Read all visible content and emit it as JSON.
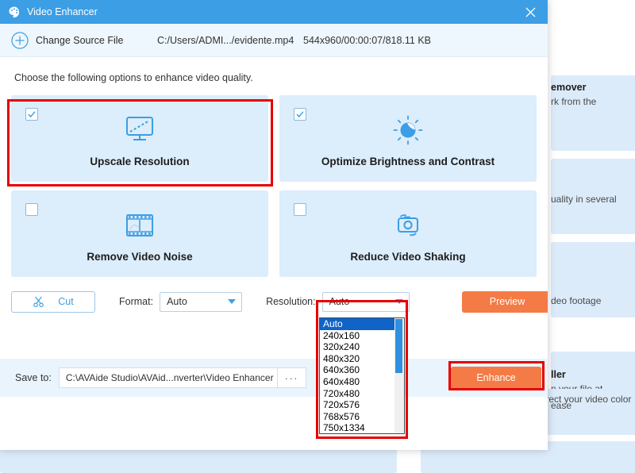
{
  "window": {
    "title": "Video Enhancer",
    "logo_icon": "palette-icon",
    "close_icon": "close-icon",
    "titlebar_color": "#3c9ee5"
  },
  "source_bar": {
    "add_icon": "plus-circle-icon",
    "change_source_label": "Change Source File",
    "file_path": "C:/Users/ADMI.../evidente.mp4",
    "file_meta": "544x960/00:00:07/818.11 KB"
  },
  "instruction": "Choose the following options to enhance video quality.",
  "options": [
    {
      "label": "Upscale Resolution",
      "icon": "monitor-upscale-icon",
      "checked": true,
      "highlighted": true
    },
    {
      "label": "Optimize Brightness and Contrast",
      "icon": "brightness-sun-icon",
      "checked": true,
      "highlighted": false
    },
    {
      "label": "Remove Video Noise",
      "icon": "film-strip-icon",
      "checked": false,
      "highlighted": false
    },
    {
      "label": "Reduce Video Shaking",
      "icon": "camera-shake-icon",
      "checked": false,
      "highlighted": false
    }
  ],
  "controls": {
    "cut_label": "Cut",
    "cut_icon": "scissors-icon",
    "format_label": "Format:",
    "format_value": "Auto",
    "resolution_label": "Resolution:",
    "resolution_value": "Auto",
    "preview_label": "Preview",
    "accent_color": "#f47b45"
  },
  "resolution_dropdown": {
    "open": true,
    "selected": "Auto",
    "options": [
      "Auto",
      "240x160",
      "320x240",
      "480x320",
      "640x360",
      "640x480",
      "720x480",
      "720x576",
      "768x576",
      "750x1334"
    ]
  },
  "save_row": {
    "save_label": "Save to:",
    "save_path": "C:\\AVAide Studio\\AVAid...nverter\\Video Enhancer",
    "browse_label": "···",
    "enhance_label": "Enhance",
    "enhance_highlighted": true
  },
  "background": {
    "cards": [
      {
        "title": "emover",
        "desc": "rk from the"
      },
      {
        "title": "",
        "desc": "uality in several"
      },
      {
        "title": "",
        "desc": "deo footage"
      },
      {
        "title": "ller",
        "desc": "n your file at"
      },
      {
        "title": "",
        "desc": "ease"
      },
      {
        "title": "",
        "desc": "Correct your video color"
      }
    ]
  },
  "highlight_color": "#e60000"
}
